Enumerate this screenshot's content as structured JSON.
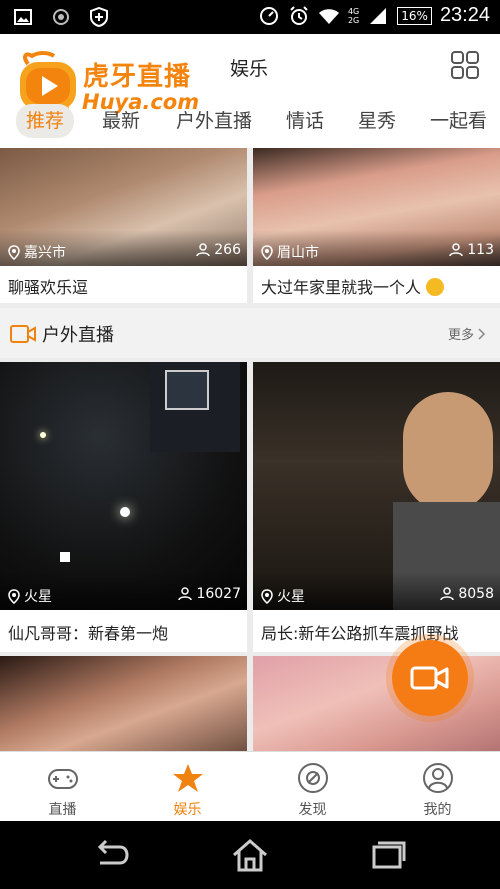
{
  "status": {
    "time": "23:24",
    "battery": "16%",
    "net_4g": "4G",
    "net_2g": "2G"
  },
  "logo": {
    "title": "虎牙直播",
    "sub": "Huya.com"
  },
  "header": {
    "title": "娱乐"
  },
  "tabs": [
    {
      "label": "推荐"
    },
    {
      "label": "最新"
    },
    {
      "label": "户外直播"
    },
    {
      "label": "情话"
    },
    {
      "label": "星秀"
    },
    {
      "label": "一起看"
    }
  ],
  "top_cards": [
    {
      "location": "嘉兴市",
      "viewers": "266",
      "title": "聊骚欢乐逗"
    },
    {
      "location": "眉山市",
      "viewers": "113",
      "title": "大过年家里就我一个人"
    }
  ],
  "section": {
    "title": "户外直播",
    "more": "更多"
  },
  "outdoor_cards": [
    {
      "location": "火星",
      "viewers": "16027",
      "title": "仙凡哥哥：新春第一炮"
    },
    {
      "location": "火星",
      "viewers": "8058",
      "title": "局长:新年公路抓车震抓野战"
    }
  ],
  "bottom_nav": [
    {
      "label": "直播",
      "icon": "gamepad-icon"
    },
    {
      "label": "娱乐",
      "icon": "star-icon"
    },
    {
      "label": "发现",
      "icon": "compass-icon"
    },
    {
      "label": "我的",
      "icon": "user-icon"
    }
  ],
  "colors": {
    "accent": "#f0820f"
  }
}
